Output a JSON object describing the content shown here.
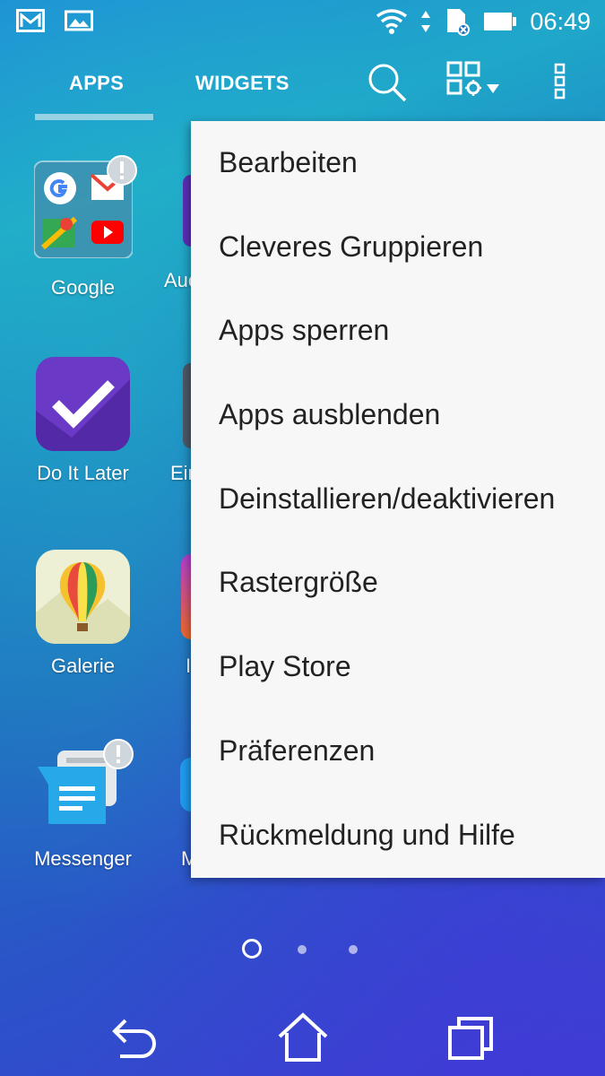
{
  "status_bar": {
    "time": "06:49",
    "left_icons": [
      "gmail-notification-icon",
      "photo-notification-icon"
    ],
    "right_icons": [
      "wifi-icon",
      "data-arrows-icon",
      "sd-card-icon",
      "battery-icon"
    ]
  },
  "top_bar": {
    "tabs": [
      {
        "label": "APPS",
        "active": true
      },
      {
        "label": "WIDGETS",
        "active": false
      }
    ],
    "actions": [
      "search-icon",
      "grid-settings-icon",
      "overflow-menu-icon"
    ]
  },
  "apps": [
    {
      "label": "Google",
      "icon": "google-folder-icon",
      "badge": "!"
    },
    {
      "label": "Do It Later",
      "icon": "do-it-later-icon"
    },
    {
      "label": "Galerie",
      "icon": "gallery-balloon-icon"
    },
    {
      "label": "Messenger",
      "icon": "messenger-icon",
      "badge": "!"
    }
  ],
  "partial_apps": [
    {
      "label": "Auc"
    },
    {
      "label": "Ein"
    },
    {
      "label": "I"
    },
    {
      "label": "M"
    }
  ],
  "menu": {
    "items": [
      "Bearbeiten",
      "Cleveres Gruppieren",
      "Apps sperren",
      "Apps ausblenden",
      "Deinstallieren/deaktivieren",
      "Rastergröße",
      "Play Store",
      "Präferenzen",
      "Rückmeldung und Hilfe"
    ]
  },
  "pager": {
    "pages": 3,
    "current": 1
  },
  "nav_bar": [
    "back-icon",
    "home-icon",
    "recents-icon"
  ],
  "colors": {
    "menu_bg": "#f7f7f7",
    "menu_text": "#222222",
    "accent_white": "#ffffff"
  }
}
